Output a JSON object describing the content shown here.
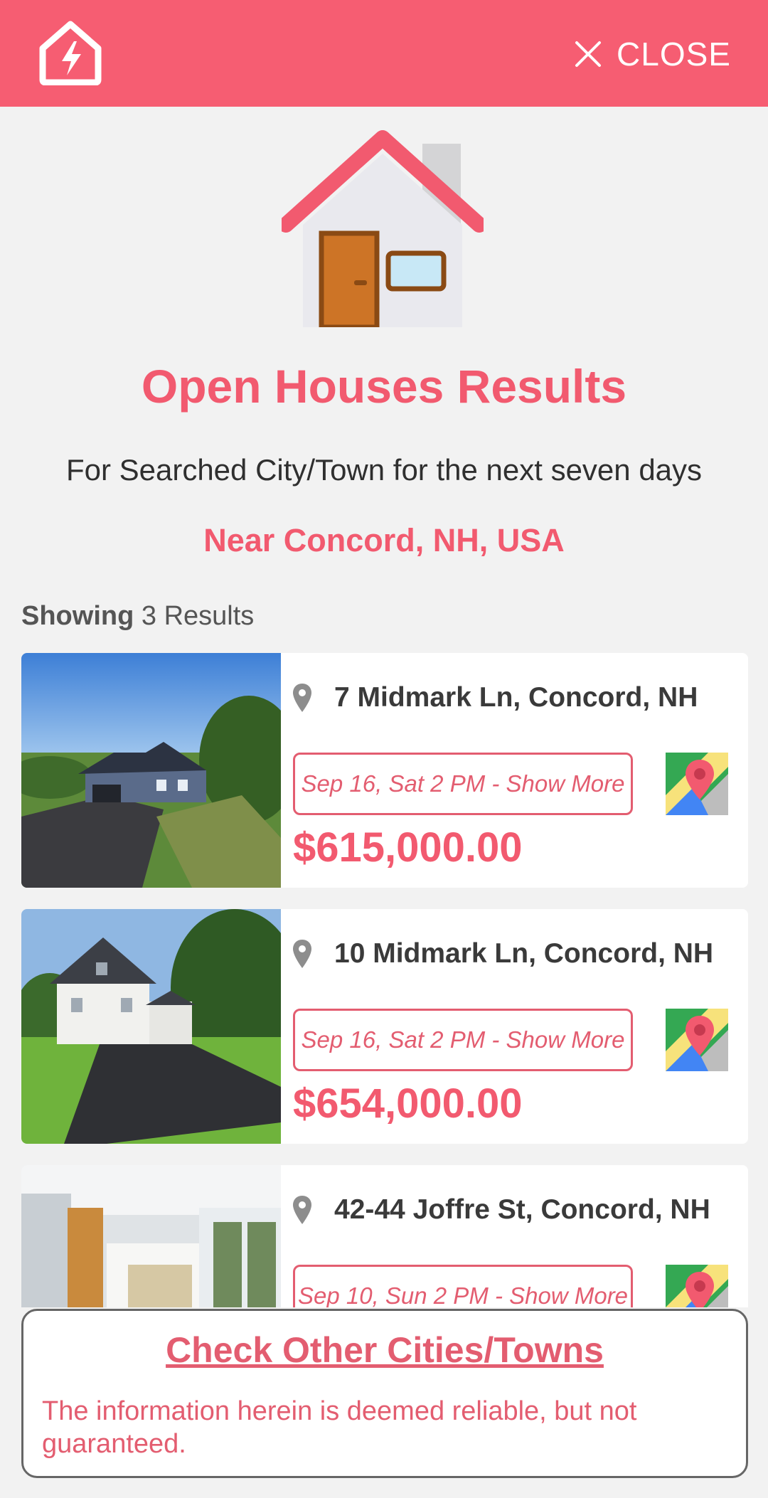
{
  "header": {
    "logo_icon": "house-lightning-icon",
    "close_icon": "close-x-icon",
    "close_label": "CLOSE",
    "bg_color": "#f65d72"
  },
  "hero": {
    "icon": "house-icon",
    "title": "Open Houses Results",
    "subtitle": "For Searched City/Town for the next seven days",
    "location": "Near Concord, NH, USA"
  },
  "results": {
    "showing_label": "Showing",
    "count_text": "3 Results",
    "items": [
      {
        "address": "7 Midmark Ln, Concord, NH",
        "date_button": "Sep 16, Sat 2 PM - Show More",
        "price": "$615,000.00",
        "maps_icon": "google-maps-icon",
        "pin_icon": "location-pin-icon"
      },
      {
        "address": "10 Midmark Ln, Concord, NH",
        "date_button": "Sep 16, Sat 2 PM - Show More",
        "price": "$654,000.00",
        "maps_icon": "google-maps-icon",
        "pin_icon": "location-pin-icon"
      },
      {
        "address": "42-44 Joffre St, Concord, NH",
        "date_button": "Sep 10, Sun 2 PM - Show More",
        "price": "",
        "maps_icon": "google-maps-icon",
        "pin_icon": "location-pin-icon"
      }
    ]
  },
  "footer": {
    "other_cities_link": "Check Other Cities/Towns",
    "disclaimer": "The information herein is deemed reliable, but not guaranteed."
  },
  "colors": {
    "accent": "#f25a6f",
    "background": "#f2f2f2"
  }
}
